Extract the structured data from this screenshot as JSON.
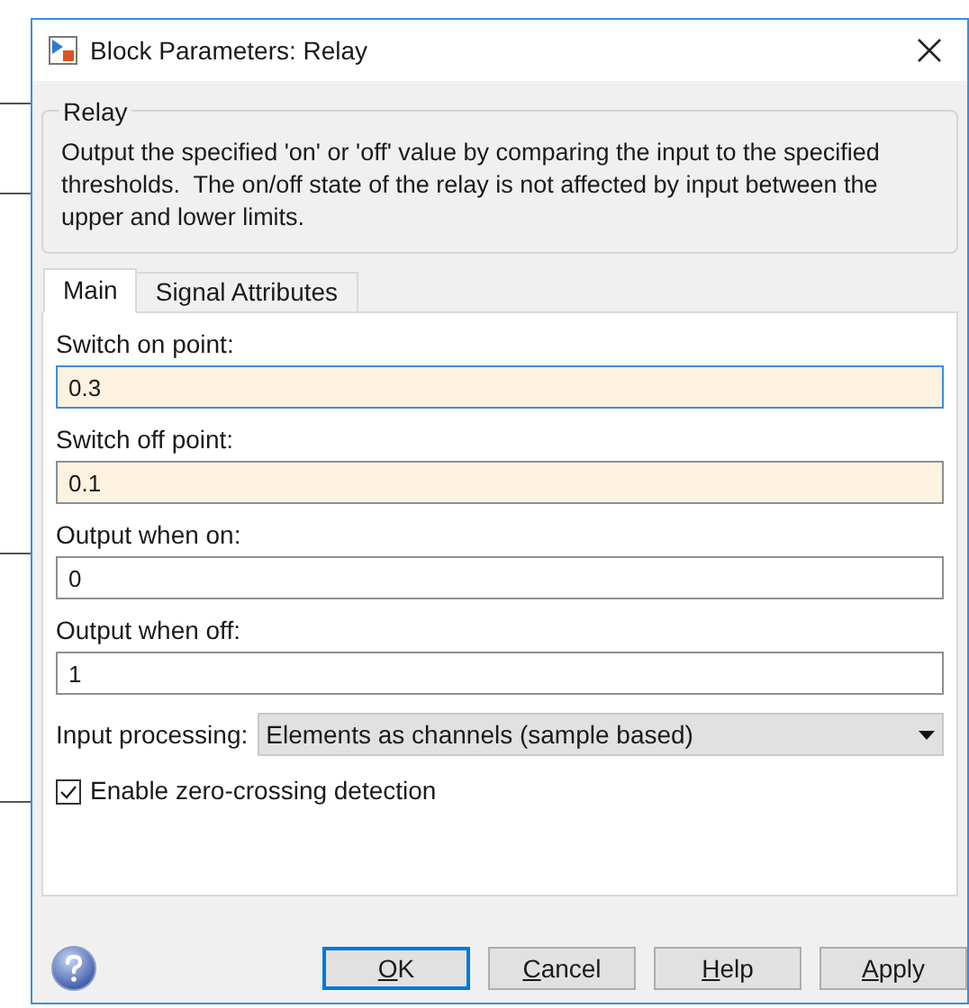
{
  "window": {
    "title": "Block Parameters: Relay"
  },
  "group": {
    "title": "Relay",
    "description": "Output the specified 'on' or 'off' value by comparing the input to the specified thresholds.  The on/off state of the relay is not affected by input between the upper and lower limits."
  },
  "tabs": [
    {
      "label": "Main",
      "selected": true
    },
    {
      "label": "Signal Attributes",
      "selected": false
    }
  ],
  "fields": [
    {
      "label": "Switch on point:",
      "value": "0.3",
      "tinted": true,
      "focused": true
    },
    {
      "label": "Switch off point:",
      "value": "0.1",
      "tinted": true,
      "focused": false
    },
    {
      "label": "Output when on:",
      "value": "0",
      "tinted": false,
      "focused": false
    },
    {
      "label": "Output when off:",
      "value": "1",
      "tinted": false,
      "focused": false
    }
  ],
  "input_processing": {
    "label": "Input processing:",
    "value": "Elements as channels (sample based)"
  },
  "zero_crossing": {
    "label": "Enable zero-crossing detection",
    "checked": true
  },
  "buttons": [
    {
      "label": "OK",
      "default": true
    },
    {
      "label": "Cancel",
      "default": false
    },
    {
      "label": "Help",
      "default": false
    },
    {
      "label": "Apply",
      "default": false
    }
  ]
}
